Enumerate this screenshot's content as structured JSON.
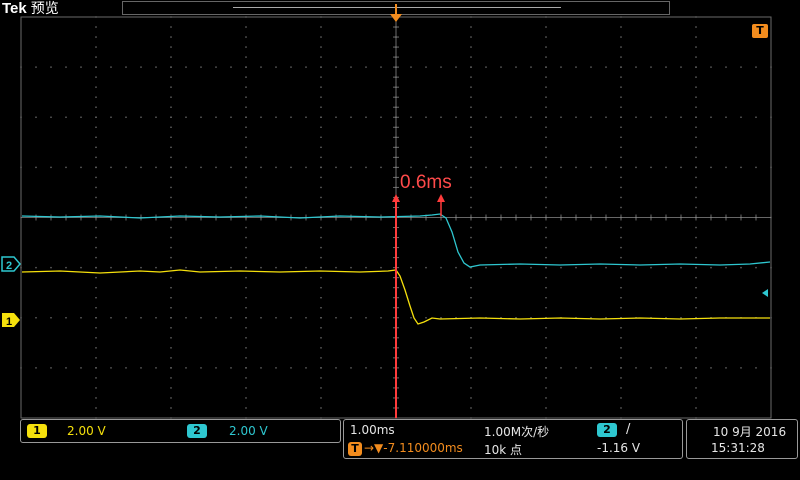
{
  "brand": {
    "logo": "Tek",
    "mode": "预览"
  },
  "annotation": {
    "delay": "0.6ms"
  },
  "trigger_marker": "T",
  "level_markers": {
    "ch1": "1",
    "ch2": "2"
  },
  "status": {
    "ch1": {
      "badge": "1",
      "scale": "2.00 V"
    },
    "ch2": {
      "badge": "2",
      "scale": "2.00 V"
    },
    "horizontal": {
      "timebase": "1.00ms",
      "sample_rate": "1.00M次/秒",
      "trigger_icon": "T",
      "position": "→▼-7.110000ms",
      "record_length": "10k 点"
    },
    "trigger": {
      "source": "2",
      "slope": "/",
      "level": "-1.16 V"
    },
    "datetime": {
      "date": "10 9月 2016",
      "time": "15:31:28"
    }
  },
  "colors": {
    "ch1": "#f5e00c",
    "ch2": "#2ec7d0",
    "trigger": "#f28c1e",
    "annotation": "#ff4a4a",
    "graticule": "#6a6a6a"
  }
}
